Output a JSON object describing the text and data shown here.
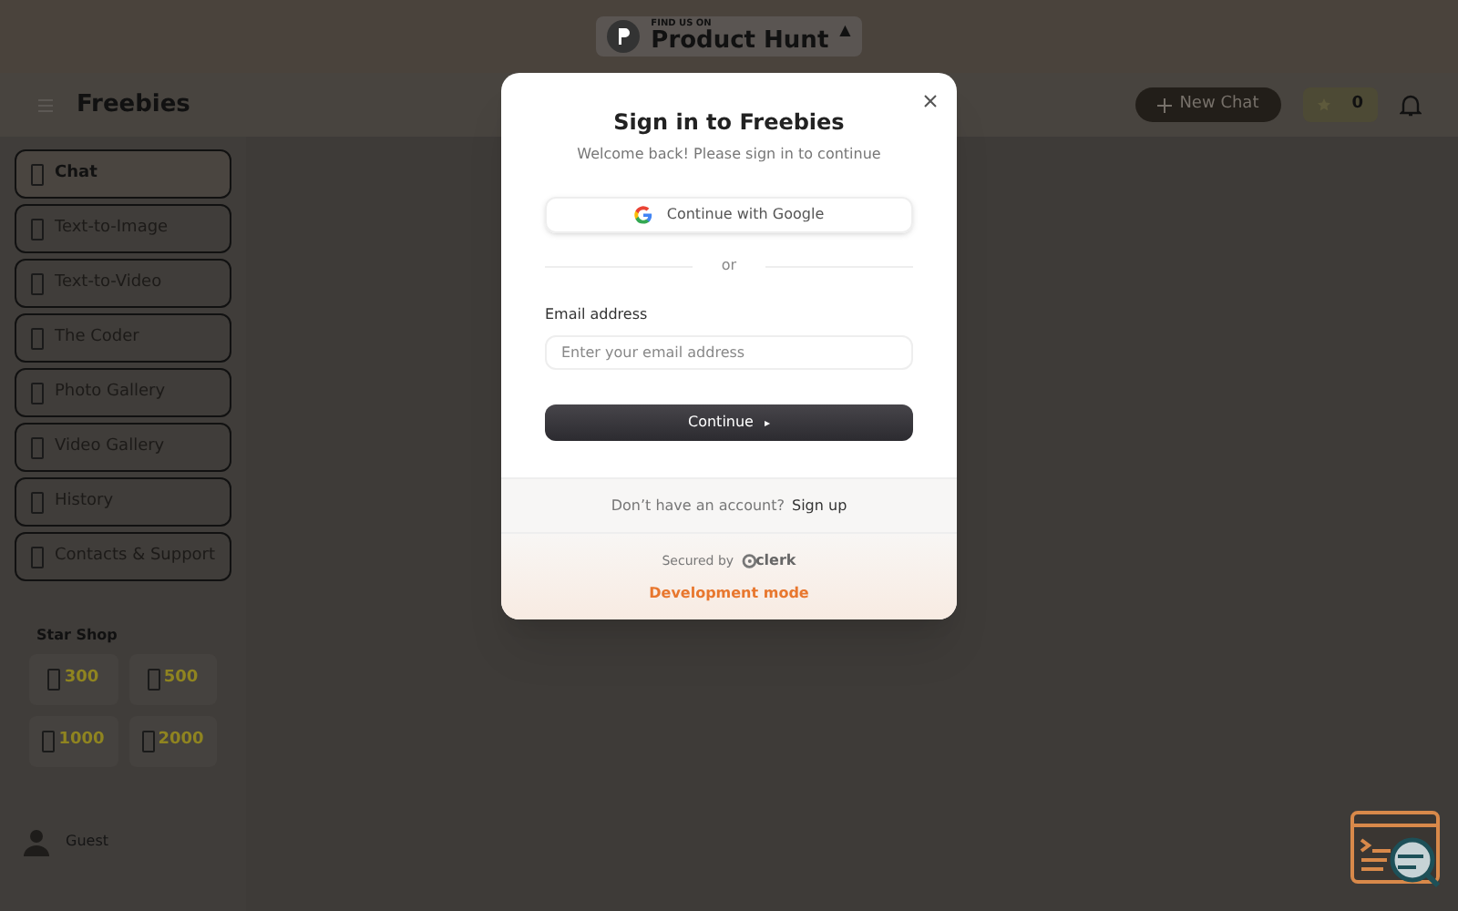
{
  "banner": {
    "caption": "FIND US ON",
    "title": "Product Hunt",
    "upvote": "▲"
  },
  "header": {
    "title": "Freebies",
    "new_chat": "New Chat",
    "stars": "0"
  },
  "sidebar": {
    "items": [
      {
        "label": "Chat",
        "selected": true
      },
      {
        "label": "Text-to-Image",
        "selected": false
      },
      {
        "label": "Text-to-Video",
        "selected": false
      },
      {
        "label": "The Coder",
        "selected": false
      },
      {
        "label": "Photo Gallery",
        "selected": false
      },
      {
        "label": "Video Gallery",
        "selected": false
      },
      {
        "label": "History",
        "selected": false
      },
      {
        "label": "Contacts & Support",
        "selected": false
      }
    ]
  },
  "star_shop": {
    "title": "Star Shop",
    "packs": [
      {
        "amount": "300"
      },
      {
        "amount": "500"
      },
      {
        "amount": "1000"
      },
      {
        "amount": "2000"
      }
    ]
  },
  "user": {
    "name": "Guest"
  },
  "modal": {
    "title": "Sign in to Freebies",
    "subtitle": "Welcome back! Please sign in to continue",
    "google_button": "Continue with Google",
    "divider": "or",
    "email_label": "Email address",
    "email_placeholder": "Enter your email address",
    "continue_button": "Continue",
    "continue_glyph": "▸",
    "signup_prompt": "Don’t have an account?",
    "signup_link": "Sign up",
    "secured_by": "Secured by",
    "brand": "clerk",
    "dev_mode": "Development mode"
  }
}
